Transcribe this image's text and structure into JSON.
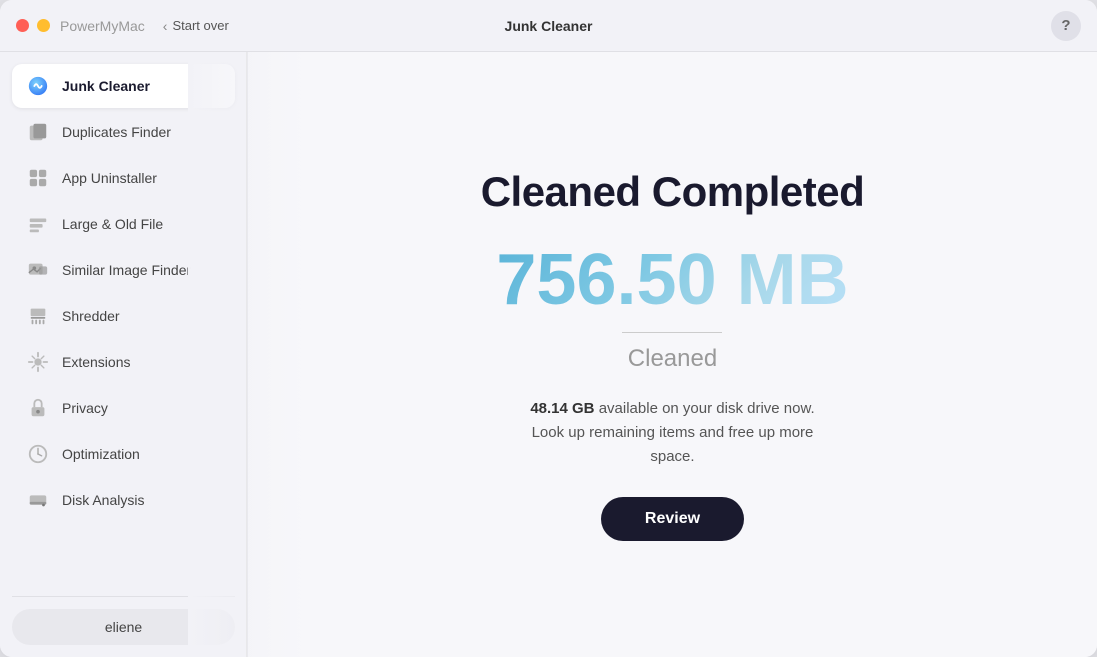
{
  "titleBar": {
    "appName": "PowerMyMac",
    "startOver": "Start over",
    "windowTitle": "Junk Cleaner",
    "helpLabel": "?"
  },
  "sidebar": {
    "items": [
      {
        "id": "junk-cleaner",
        "label": "Junk Cleaner",
        "active": true
      },
      {
        "id": "duplicates-finder",
        "label": "Duplicates Finder",
        "active": false
      },
      {
        "id": "app-uninstaller",
        "label": "App Uninstaller",
        "active": false
      },
      {
        "id": "large-old-file",
        "label": "Large & Old File",
        "active": false
      },
      {
        "id": "similar-image-finder",
        "label": "Similar Image Finder",
        "active": false
      },
      {
        "id": "shredder",
        "label": "Shredder",
        "active": false
      },
      {
        "id": "extensions",
        "label": "Extensions",
        "active": false
      },
      {
        "id": "privacy",
        "label": "Privacy",
        "active": false
      },
      {
        "id": "optimization",
        "label": "Optimization",
        "active": false
      },
      {
        "id": "disk-analysis",
        "label": "Disk Analysis",
        "active": false
      }
    ],
    "user": "eliene"
  },
  "content": {
    "title": "Cleaned Completed",
    "amount": "756.50 MB",
    "cleanedLabel": "Cleaned",
    "diskSpace": "48.14 GB",
    "description": " available on your disk drive now. Look up remaining items and free up more space.",
    "reviewButton": "Review"
  }
}
